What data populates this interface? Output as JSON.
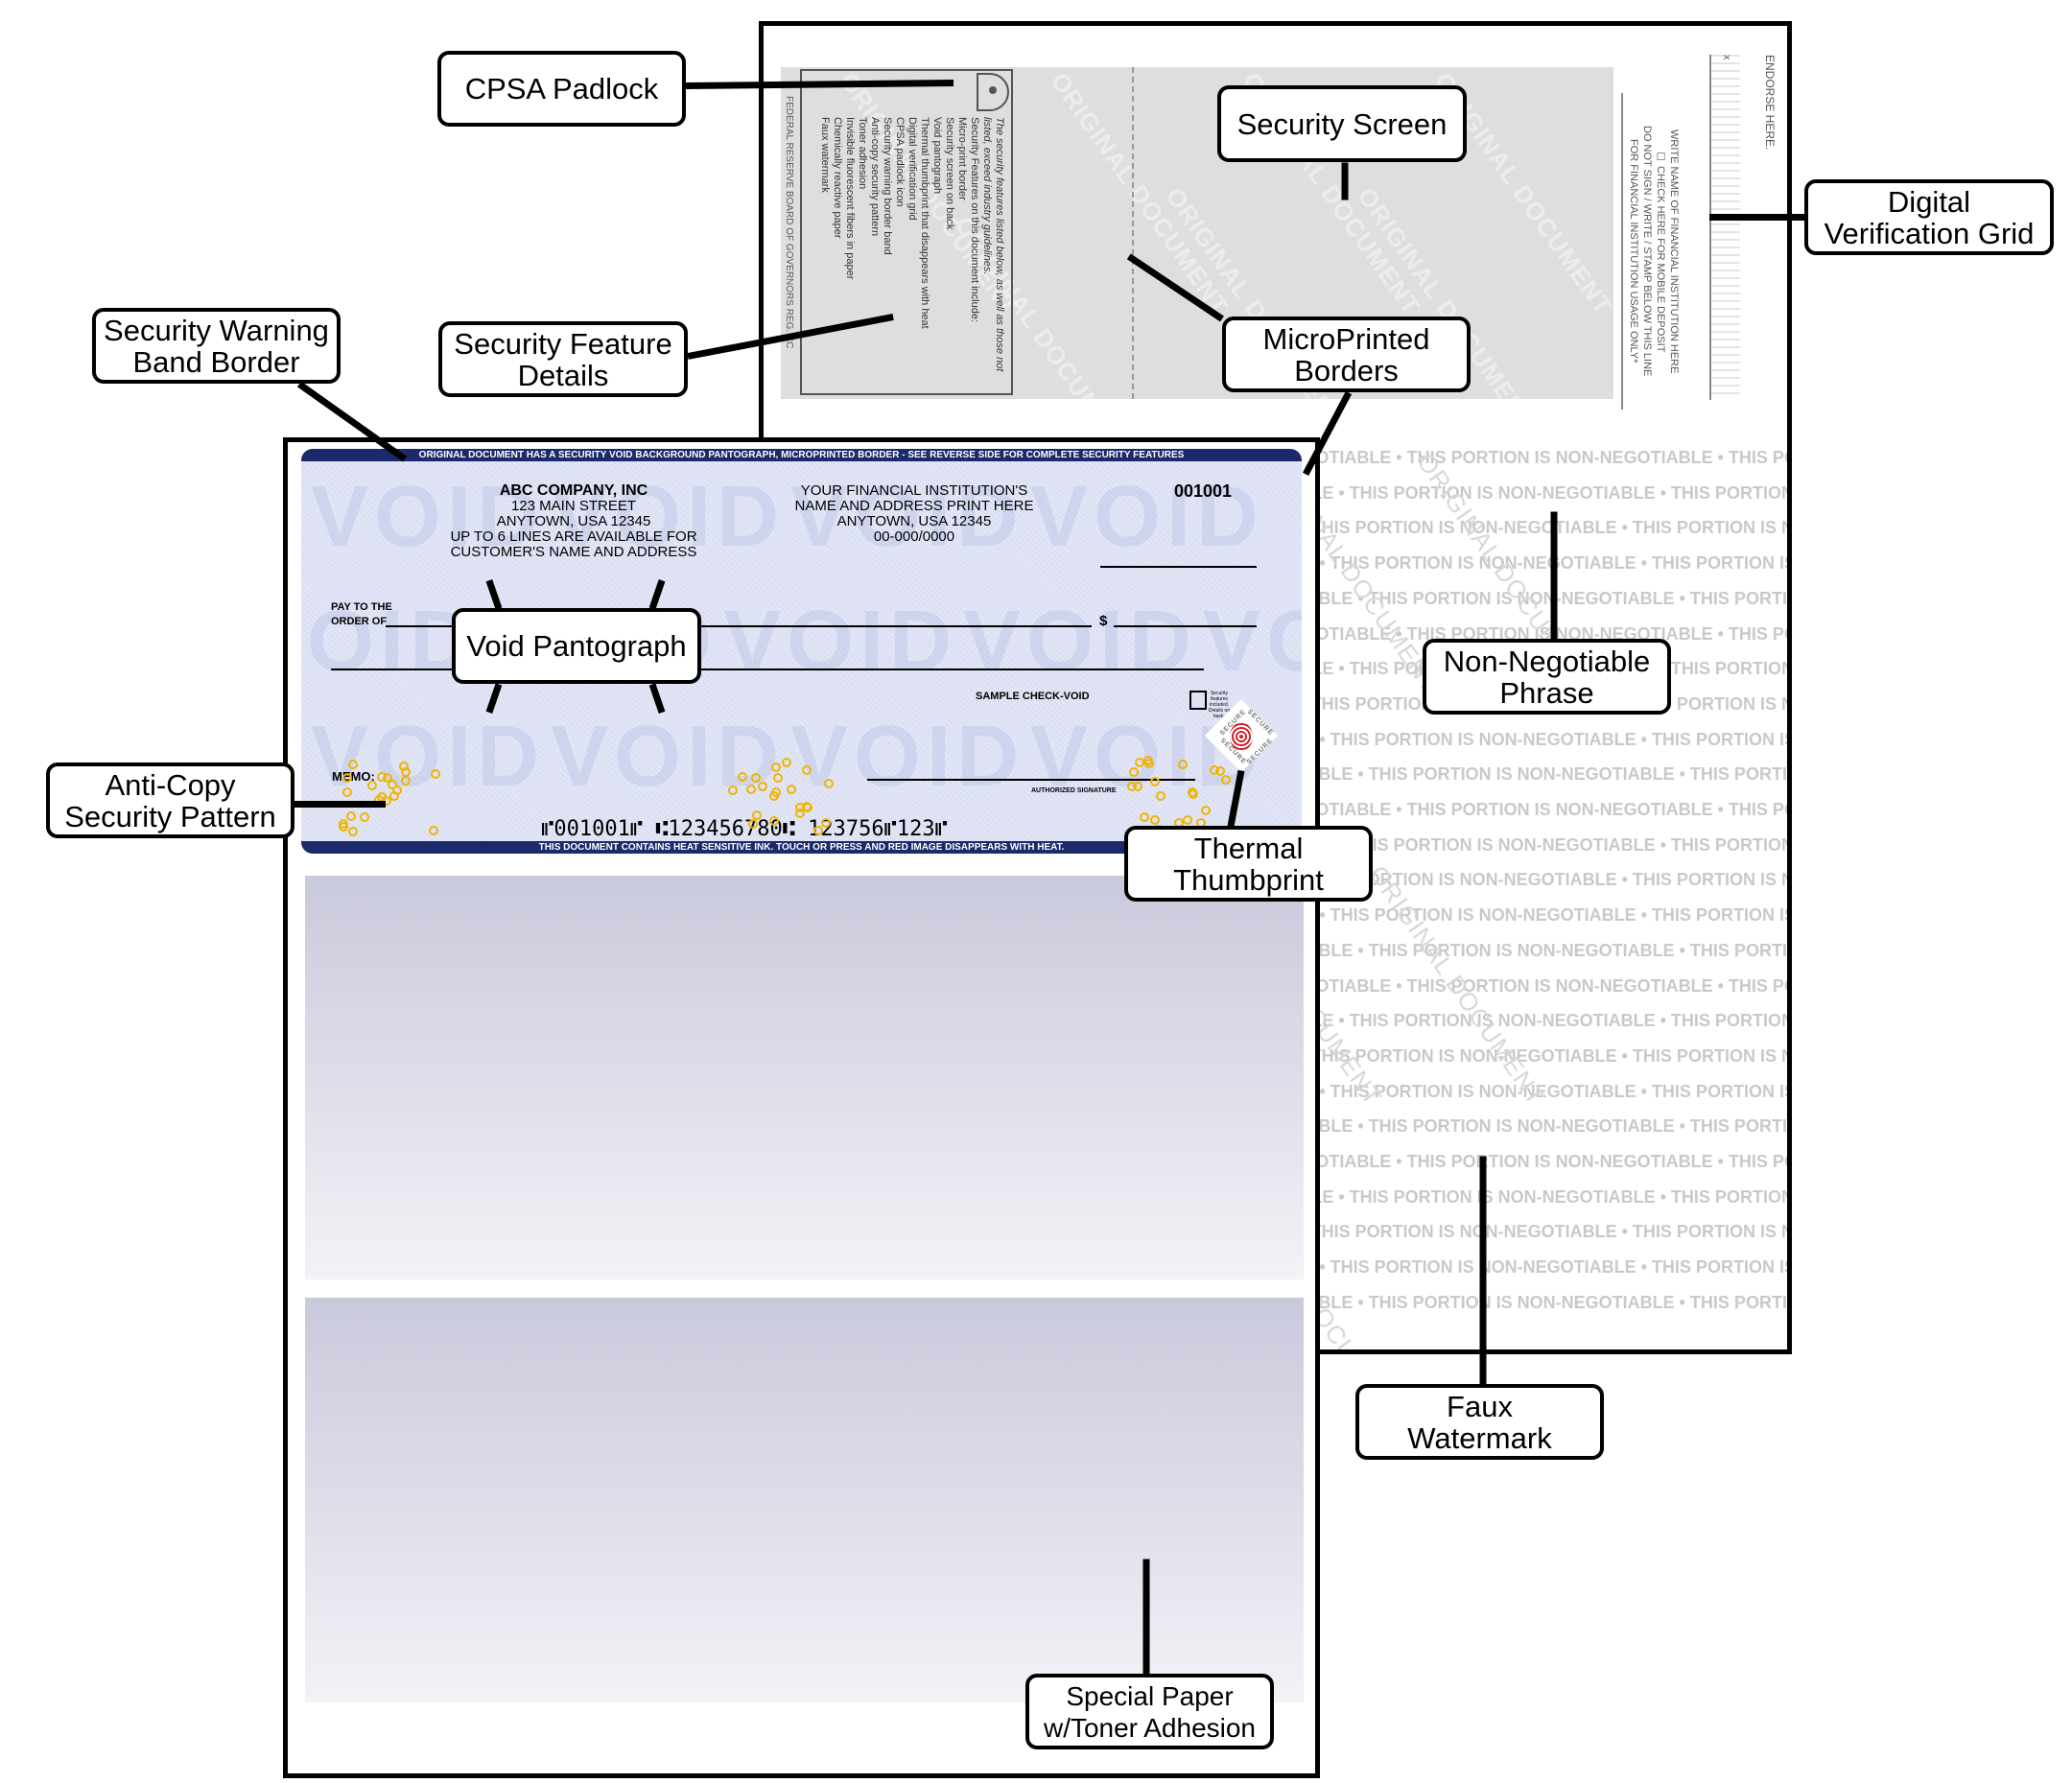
{
  "callouts": {
    "cpsa_padlock": "CPSA Padlock",
    "security_screen": "Security Screen",
    "digital_verification_grid": [
      "Digital",
      "Verification Grid"
    ],
    "security_warning_band_border": [
      "Security Warning",
      "Band Border"
    ],
    "security_feature_details": [
      "Security Feature",
      "Details"
    ],
    "microprinted_borders": [
      "MicroPrinted",
      "Borders"
    ],
    "void_pantograph": "Void Pantograph",
    "non_negotiable_phrase": [
      "Non-Negotiable",
      "Phrase"
    ],
    "anti_copy_security_pattern": [
      "Anti-Copy",
      "Security Pattern"
    ],
    "thermal_thumbprint": [
      "Thermal",
      "Thumbprint"
    ],
    "faux_watermark": [
      "Faux",
      "Watermark"
    ],
    "special_paper": [
      "Special Paper",
      "w/Toner Adhesion"
    ]
  },
  "back": {
    "intro": "The security features listed below, as well as those not listed, exceed industry guidelines.",
    "features_heading": "Security Features on this document include:",
    "features": [
      "Micro-print border",
      "Security screen on back",
      "Void pantograph",
      "Thermal thumbprint that disappears with heat",
      "Digital verification grid",
      "CPSA padlock icon",
      "Security warning border band",
      "Anti-copy security pattern",
      "Toner adhesion",
      "Invisible fluorescent fibers in paper",
      "Chemically reactive paper",
      "Faux watermark"
    ],
    "footer": "FEDERAL RESERVE BOARD OF GOVERNORS REG. CC",
    "endorse": "ENDORSE HERE.",
    "x_mark": "x",
    "institution_name": "WRITE NAME OF FINANCIAL INSTITUTION HERE",
    "mobile_deposit": "☐ CHECK HERE FOR MOBILE DEPOSIT",
    "do_not_sign": "DO NOT SIGN / WRITE / STAMP BELOW THIS LINE",
    "usage_only": "FOR FINANCIAL INSTITUTION USAGE ONLY*",
    "watermark": "ORIGINAL DOCUMENT",
    "non_negotiable": "THIS PORTION IS NON-NEGOTIABLE"
  },
  "check": {
    "top_band": "ORIGINAL DOCUMENT HAS A SECURITY VOID BACKGROUND PANTOGRAPH, MICROPRINTED BORDER - SEE REVERSE SIDE FOR COMPLETE SECURITY FEATURES",
    "company_name": "ABC COMPANY, INC",
    "company_lines": [
      "123 MAIN STREET",
      "ANYTOWN, USA 12345",
      "UP TO 6 LINES ARE AVAILABLE FOR",
      "CUSTOMER'S NAME AND ADDRESS"
    ],
    "bank_lines": [
      "YOUR FINANCIAL INSTITUTION'S",
      "NAME AND ADDRESS PRINT HERE",
      "ANYTOWN, USA 12345",
      "00-000/0000"
    ],
    "check_number": "001001",
    "pay_to": [
      "PAY TO THE",
      "ORDER OF"
    ],
    "dollar": "$",
    "sample_void": "SAMPLE CHECK-VOID",
    "padlock_note": "Security features included. Details on back.",
    "secure": "SECURE",
    "memo": "MEMO:",
    "signature_label": "AUTHORIZED SIGNATURE",
    "micr": "⑈001001⑈ ⑆123456780⑆  123756⑈123⑈",
    "void_text": "VOID",
    "bottom_band": "THIS DOCUMENT CONTAINS HEAT SENSITIVE INK. TOUCH OR PRESS AND RED IMAGE DISAPPEARS WITH HEAT."
  },
  "colors": {
    "band": "#1c2a6b",
    "pattern_dots": "#f0b400",
    "thumbprint": "#d0202a"
  }
}
